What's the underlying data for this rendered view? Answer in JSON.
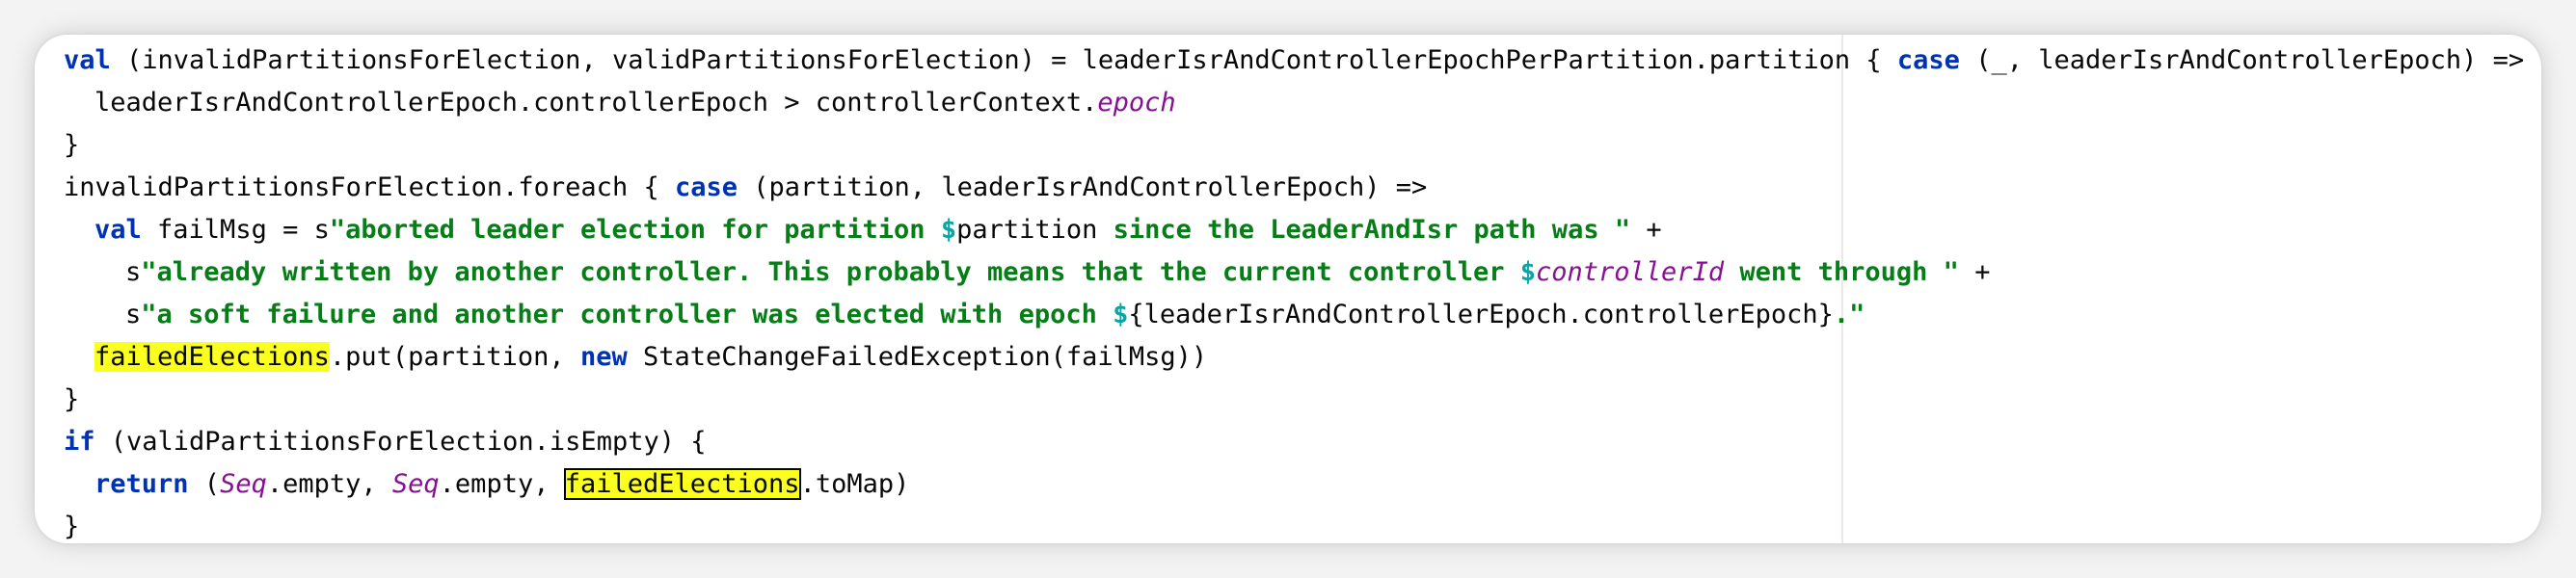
{
  "editor": {
    "lines": [
      {
        "indent": 0,
        "tokens": [
          {
            "t": "val",
            "c": "kw"
          },
          {
            "t": " (invalidPartitionsForElection, validPartitionsForElection) = leaderIsrAndControllerEpochPerPartition.partition { "
          },
          {
            "t": "case",
            "c": "kw"
          },
          {
            "t": " (_, leaderIsrAndControllerEpoch) =>"
          }
        ]
      },
      {
        "indent": 1,
        "tokens": [
          {
            "t": "leaderIsrAndControllerEpoch.controllerEpoch > controllerContext."
          },
          {
            "t": "epoch",
            "c": "it"
          }
        ]
      },
      {
        "indent": 0,
        "tokens": [
          {
            "t": "}"
          }
        ]
      },
      {
        "indent": 0,
        "tokens": [
          {
            "t": "invalidPartitionsForElection.foreach { "
          },
          {
            "t": "case",
            "c": "kw"
          },
          {
            "t": " (partition, leaderIsrAndControllerEpoch) =>"
          }
        ]
      },
      {
        "indent": 1,
        "tokens": [
          {
            "t": "val",
            "c": "kw"
          },
          {
            "t": " failMsg = s"
          },
          {
            "t": "\"aborted leader election for partition ",
            "c": "str"
          },
          {
            "t": "$",
            "c": "dol"
          },
          {
            "t": "partition"
          },
          {
            "t": " since the LeaderAndIsr path was \"",
            "c": "str"
          },
          {
            "t": " +"
          }
        ]
      },
      {
        "indent": 2,
        "tokens": [
          {
            "t": "s"
          },
          {
            "t": "\"already written by another controller. This probably means that the current controller ",
            "c": "str"
          },
          {
            "t": "$",
            "c": "dol"
          },
          {
            "t": "controllerId",
            "c": "it"
          },
          {
            "t": " went through \"",
            "c": "str"
          },
          {
            "t": " +"
          }
        ]
      },
      {
        "indent": 2,
        "tokens": [
          {
            "t": "s"
          },
          {
            "t": "\"a soft failure and another controller was elected with epoch ",
            "c": "str"
          },
          {
            "t": "$",
            "c": "dol"
          },
          {
            "t": "{leaderIsrAndControllerEpoch.controllerEpoch}"
          },
          {
            "t": ".\"",
            "c": "str"
          }
        ]
      },
      {
        "indent": 1,
        "tokens": [
          {
            "t": "failedElections",
            "c": "hl"
          },
          {
            "t": ".put(partition, "
          },
          {
            "t": "new",
            "c": "kw"
          },
          {
            "t": " StateChangeFailedException(failMsg))"
          }
        ]
      },
      {
        "indent": 0,
        "tokens": [
          {
            "t": "}"
          }
        ]
      },
      {
        "indent": 0,
        "tokens": [
          {
            "t": "if",
            "c": "kw"
          },
          {
            "t": " (validPartitionsForElection.isEmpty) {"
          }
        ]
      },
      {
        "indent": 1,
        "tokens": [
          {
            "t": "return",
            "c": "kw"
          },
          {
            "t": " ("
          },
          {
            "t": "Seq",
            "c": "it"
          },
          {
            "t": ".empty, "
          },
          {
            "t": "Seq",
            "c": "it"
          },
          {
            "t": ".empty, "
          },
          {
            "t": "failedElections",
            "c": "hl-box"
          },
          {
            "t": ".toMap)"
          }
        ]
      },
      {
        "indent": 0,
        "tokens": [
          {
            "t": "}"
          }
        ]
      }
    ]
  },
  "colors": {
    "keyword": "#0033b3",
    "string": "#067d17",
    "italic_identifier": "#871094",
    "interpolation": "#0aa5a5",
    "highlight": "#fbff1f",
    "plain": "#080808"
  }
}
